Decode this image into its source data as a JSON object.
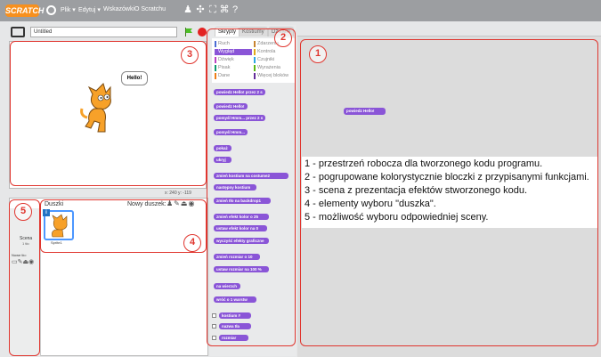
{
  "topbar": {
    "logo": "SCRATCH",
    "menus": [
      "Plik",
      "Edytuj",
      "Wskazówki",
      "O Scratchu"
    ]
  },
  "stage": {
    "project_title": "Untitled",
    "speech": "Hello!",
    "coords": "x: 240  y: -119"
  },
  "sprites": {
    "title": "Duszki",
    "new_sprite": "Nowy duszek:",
    "sprite_name": "Sprite1",
    "scene_label": "Scena",
    "scene_sub": "1 tło",
    "new_bg": "Nowe tło:"
  },
  "palette": {
    "tabs": [
      "Skrypty",
      "Kostiumy",
      "Dźwięki"
    ],
    "categories": [
      {
        "label": "Ruch",
        "color": "#4a6cd4"
      },
      {
        "label": "Zdarzenia",
        "color": "#c88330"
      },
      {
        "label": "Wygląd",
        "color": "#8a55d7",
        "selected": true
      },
      {
        "label": "Kontrola",
        "color": "#e1a91a"
      },
      {
        "label": "Dźwięk",
        "color": "#bb42c3"
      },
      {
        "label": "Czujniki",
        "color": "#2ca5e2"
      },
      {
        "label": "Pisak",
        "color": "#0e9a6c"
      },
      {
        "label": "Wyrażenia",
        "color": "#5cb712"
      },
      {
        "label": "Dane",
        "color": "#ee7d16"
      },
      {
        "label": "Więcej bloków",
        "color": "#632d99"
      }
    ],
    "blocks": [
      "powiedz Hello! przez 2 s",
      "powiedz Hello!",
      "pomyśl Hmm... przez 2 s",
      "pomyśl Hmm...",
      "pokaż",
      "ukryj",
      "zmień kostium na costume2",
      "następny kostium",
      "zmień tło na backdrop1",
      "zmień efekt kolor o 25",
      "ustaw efekt kolor na 0",
      "wyczyść efekty graficzne",
      "zmień rozmiar o 10",
      "ustaw rozmiar na 100 %",
      "na wierzch",
      "wróć o 1 warstw",
      "kostium #",
      "nazwa tła",
      "rozmiar"
    ]
  },
  "script_area": {
    "block": "powiedz Hello!"
  },
  "legend": {
    "lines": [
      "1 - przestrzeń robocza dla tworzonego kodu programu.",
      "2 - pogrupowane kolorystycznie bloczki z przypisanymi funkcjami.",
      "3 - scena z prezentacja efektów stworzonego kodu.",
      "4 - elementy wyboru \"duszka\".",
      "5 - możliwość wyboru odpowiedniej sceny."
    ]
  },
  "badges": [
    "1",
    "2",
    "3",
    "4",
    "5"
  ],
  "colors": {
    "accent_red": "#e0362f",
    "looks_purple": "#8a55d7",
    "topbar_gray": "#9c9ea1"
  }
}
